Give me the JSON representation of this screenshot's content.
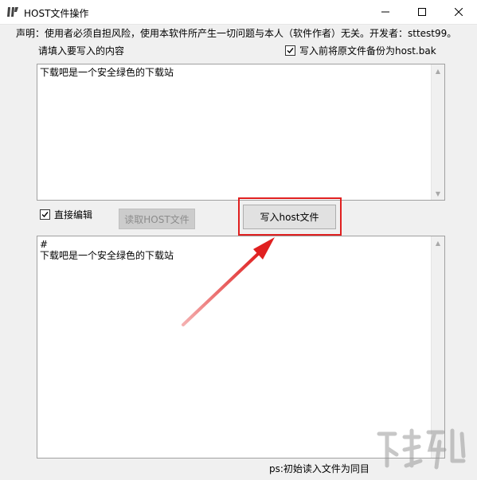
{
  "window": {
    "title": "HOST文件操作",
    "icons": {
      "app": "app-logo-icon",
      "minimize": "minimize-icon",
      "maximize": "maximize-icon",
      "close": "close-icon"
    }
  },
  "disclaimer": "声明：使用者必须自担风险，使用本软件所产生一切问题与本人（软件作者）无关。开发者：sttest99。",
  "input_prompt": "请填入要写入的内容",
  "backup_checkbox": {
    "label": "写入前将原文件备份为host.bak",
    "checked": true
  },
  "input_box": {
    "value": "下载吧是一个安全绿色的下载站"
  },
  "direct_edit_checkbox": {
    "label": "直接编辑",
    "checked": true
  },
  "read_button": {
    "label": "读取HOST文件",
    "enabled": false
  },
  "write_button": {
    "label": "写入host文件"
  },
  "host_box": {
    "value": "#\n下载吧是一个安全绿色的下载站"
  },
  "note": "ps:初始读入文件为同目",
  "annotation": {
    "highlight_color": "#e02020",
    "arrow_color": "#e02020"
  }
}
